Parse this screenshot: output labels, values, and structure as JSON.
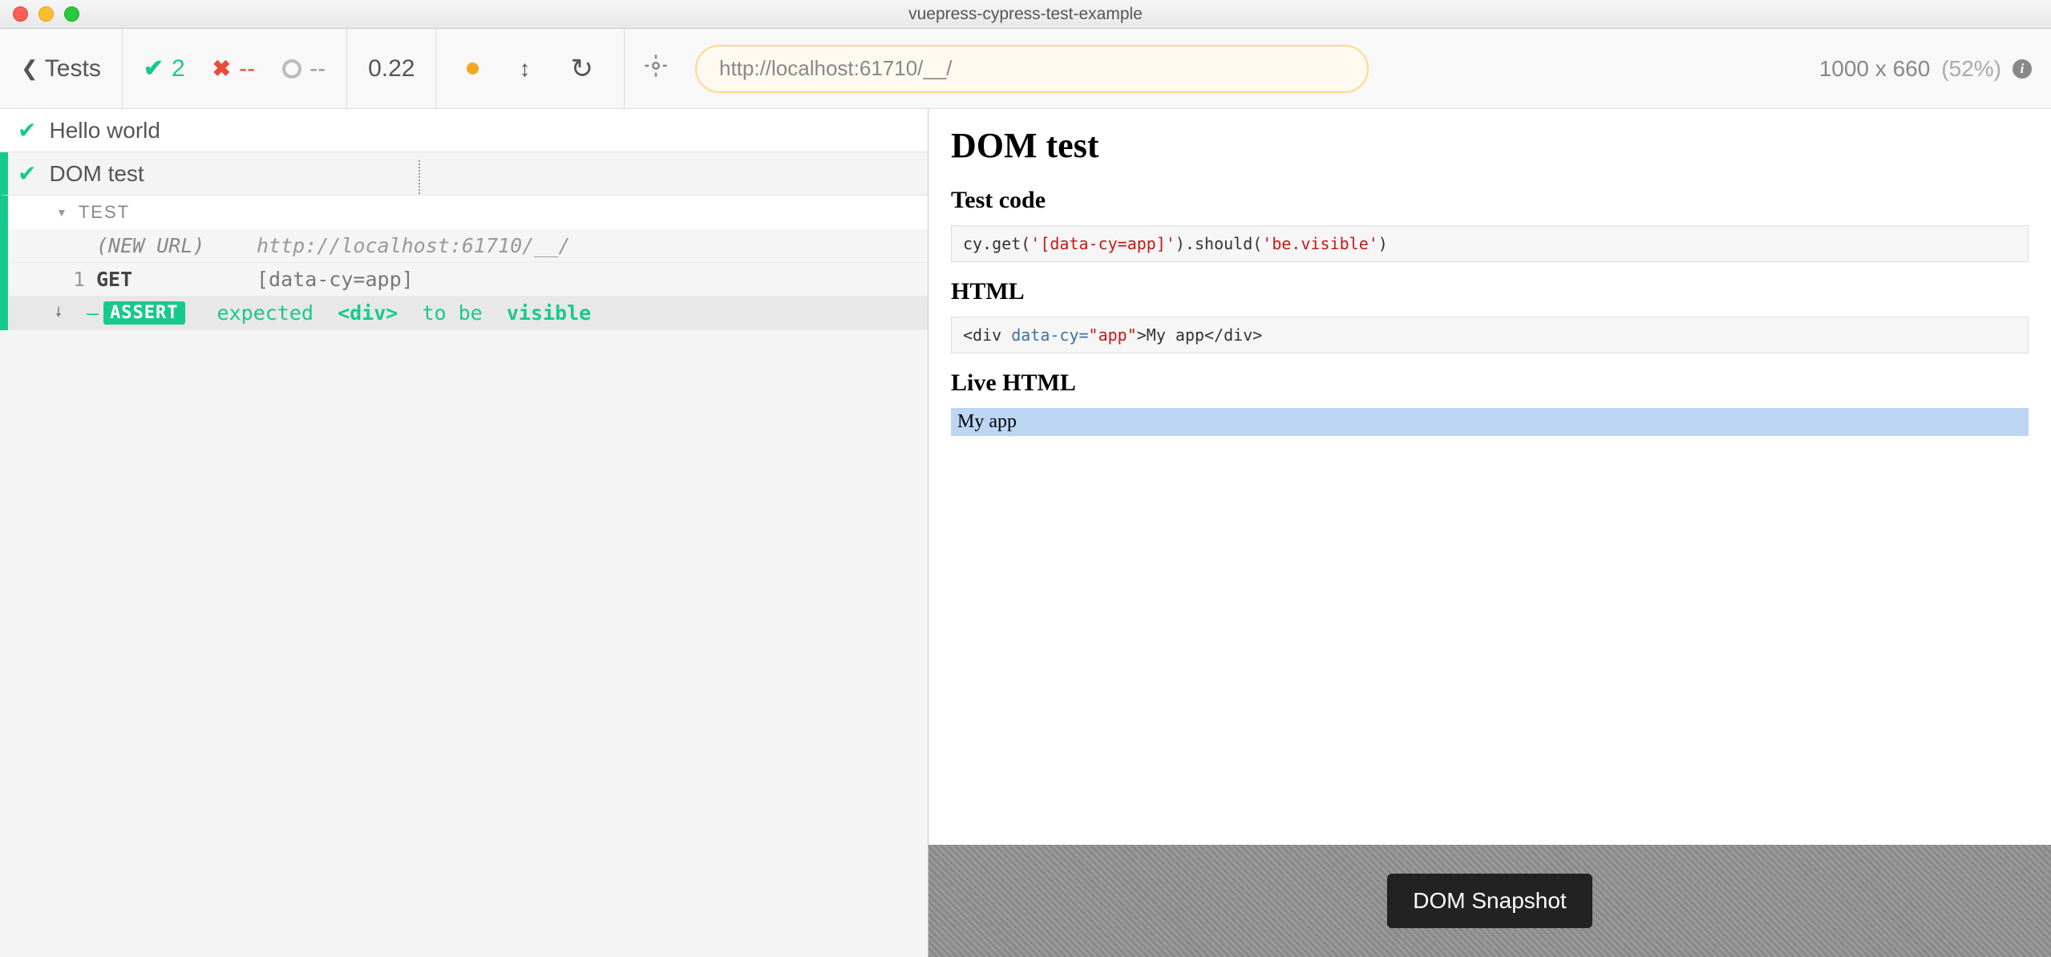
{
  "window": {
    "title": "vuepress-cypress-test-example"
  },
  "toolbar": {
    "tests_label": "Tests",
    "passed": "2",
    "failed": "--",
    "pending": "--",
    "time": "0.22",
    "url": "http://localhost:61710/__/",
    "viewport": "1000 x 660",
    "zoom": "(52%)"
  },
  "runner": {
    "test1": "Hello world",
    "test2": "DOM test",
    "section_label": "TEST",
    "cmds": {
      "new_url": {
        "label": "(NEW URL)",
        "msg": "http://localhost:61710/__/"
      },
      "get": {
        "num": "1",
        "label": "GET",
        "msg": "[data-cy=app]"
      },
      "assert": {
        "badge": "ASSERT",
        "p1": "expected",
        "tag": "<div>",
        "p2": "to be",
        "vis": "visible"
      }
    }
  },
  "preview": {
    "h1": "DOM test",
    "h2a": "Test code",
    "code_a_p1": "cy.get(",
    "code_a_s1": "'[data-cy=app]'",
    "code_a_p2": ").should(",
    "code_a_s2": "'be.visible'",
    "code_a_p3": ")",
    "h2b": "HTML",
    "code_b_p1": "<div ",
    "code_b_attr_k": "data-cy=",
    "code_b_attr_v": "\"app\"",
    "code_b_p2": ">My app</div>",
    "h2c": "Live HTML",
    "live": "My app"
  },
  "footer": {
    "snapshot": "DOM Snapshot"
  }
}
